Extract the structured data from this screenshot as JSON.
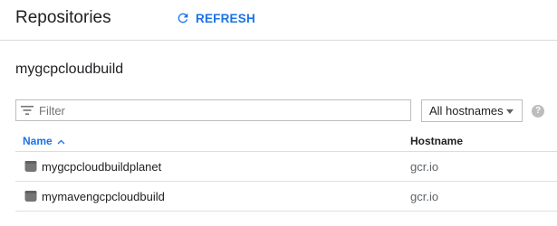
{
  "header": {
    "title": "Repositories",
    "refresh_label": "REFRESH",
    "refresh_icon": "refresh-icon"
  },
  "project": {
    "name": "mygcpcloudbuild"
  },
  "filter": {
    "placeholder": "Filter",
    "value": "",
    "icon": "filter-list-icon"
  },
  "hostname_select": {
    "selected": "All hostnames"
  },
  "help": {
    "glyph": "?"
  },
  "table": {
    "columns": {
      "name": "Name",
      "name_sort": "▲",
      "hostname": "Hostname"
    },
    "rows": [
      {
        "name": "mygcpcloudbuildplanet",
        "hostname": "gcr.io"
      },
      {
        "name": "mymavengcpcloudbuild",
        "hostname": "gcr.io"
      }
    ]
  },
  "colors": {
    "accent": "#1a73e8",
    "text": "#202124",
    "muted": "#5f6368",
    "border": "#dadce0"
  }
}
